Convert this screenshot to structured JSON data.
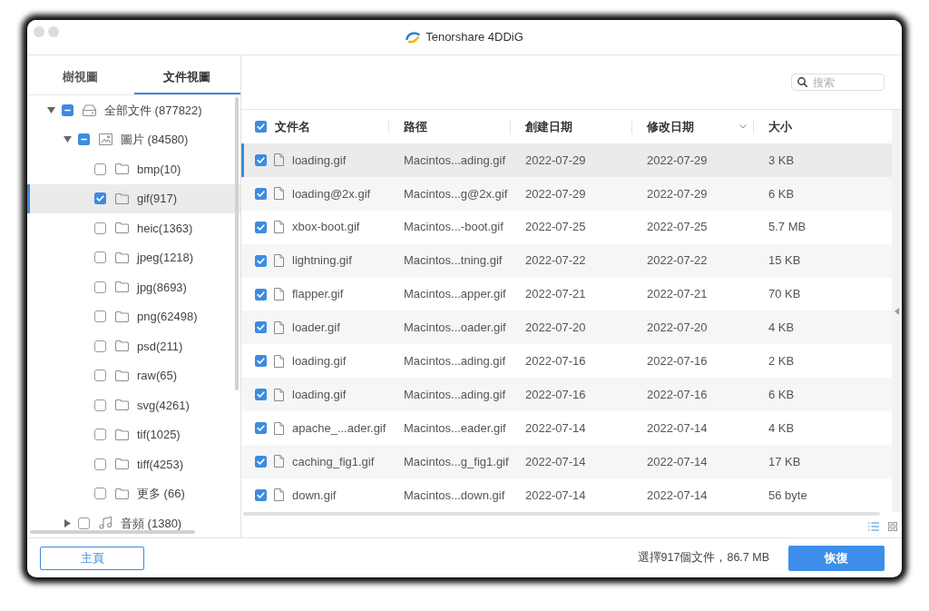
{
  "window": {
    "title": "Tenorshare 4DDiG"
  },
  "sidebar": {
    "tabs": [
      {
        "label": "樹視圖",
        "selected": false
      },
      {
        "label": "文件視圖",
        "selected": true
      }
    ],
    "tree": [
      {
        "kind": "drive",
        "label": "全部文件 (877822)",
        "checked": false,
        "indeterminate": true,
        "expanded": true,
        "selected": false,
        "children": [
          {
            "kind": "image",
            "label": "圖片 (84580)",
            "checked": false,
            "indeterminate": true,
            "expanded": true,
            "selected": false,
            "children": [
              {
                "kind": "folder",
                "label": "bmp(10)",
                "checked": false,
                "indeterminate": false,
                "selected": false
              },
              {
                "kind": "folder",
                "label": "gif(917)",
                "checked": true,
                "indeterminate": false,
                "selected": true
              },
              {
                "kind": "folder",
                "label": "heic(1363)",
                "checked": false,
                "indeterminate": false,
                "selected": false
              },
              {
                "kind": "folder",
                "label": "jpeg(1218)",
                "checked": false,
                "indeterminate": false,
                "selected": false
              },
              {
                "kind": "folder",
                "label": "jpg(8693)",
                "checked": false,
                "indeterminate": false,
                "selected": false
              },
              {
                "kind": "folder",
                "label": "png(62498)",
                "checked": false,
                "indeterminate": false,
                "selected": false
              },
              {
                "kind": "folder",
                "label": "psd(211)",
                "checked": false,
                "indeterminate": false,
                "selected": false
              },
              {
                "kind": "folder",
                "label": "raw(65)",
                "checked": false,
                "indeterminate": false,
                "selected": false
              },
              {
                "kind": "folder",
                "label": "svg(4261)",
                "checked": false,
                "indeterminate": false,
                "selected": false
              },
              {
                "kind": "folder",
                "label": "tif(1025)",
                "checked": false,
                "indeterminate": false,
                "selected": false
              },
              {
                "kind": "folder",
                "label": "tiff(4253)",
                "checked": false,
                "indeterminate": false,
                "selected": false
              },
              {
                "kind": "folder",
                "label": "更多 (66)",
                "checked": false,
                "indeterminate": false,
                "selected": false
              }
            ]
          },
          {
            "kind": "audio",
            "label": "音頻 (1380)",
            "checked": false,
            "indeterminate": false,
            "expanded": false,
            "selected": false
          }
        ]
      }
    ]
  },
  "search": {
    "placeholder": "搜索"
  },
  "table": {
    "all_checked": true,
    "columns": [
      {
        "label": "文件名",
        "sorted": false
      },
      {
        "label": "路徑",
        "sorted": false
      },
      {
        "label": "創建日期",
        "sorted": false
      },
      {
        "label": "修改日期",
        "sorted": true
      },
      {
        "label": "大小",
        "sorted": false
      }
    ],
    "rows": [
      {
        "name": "loading.gif",
        "path": "Macintos...ading.gif",
        "created": "2022-07-29",
        "modified": "2022-07-29",
        "size": "3 KB",
        "checked": true,
        "selected": true
      },
      {
        "name": "loading@2x.gif",
        "path": "Macintos...g@2x.gif",
        "created": "2022-07-29",
        "modified": "2022-07-29",
        "size": "6 KB",
        "checked": true,
        "selected": false
      },
      {
        "name": "xbox-boot.gif",
        "path": "Macintos...-boot.gif",
        "created": "2022-07-25",
        "modified": "2022-07-25",
        "size": "5.7 MB",
        "checked": true,
        "selected": false
      },
      {
        "name": "lightning.gif",
        "path": "Macintos...tning.gif",
        "created": "2022-07-22",
        "modified": "2022-07-22",
        "size": "15 KB",
        "checked": true,
        "selected": false
      },
      {
        "name": "flapper.gif",
        "path": "Macintos...apper.gif",
        "created": "2022-07-21",
        "modified": "2022-07-21",
        "size": "70 KB",
        "checked": true,
        "selected": false
      },
      {
        "name": "loader.gif",
        "path": "Macintos...oader.gif",
        "created": "2022-07-20",
        "modified": "2022-07-20",
        "size": "4 KB",
        "checked": true,
        "selected": false
      },
      {
        "name": "loading.gif",
        "path": "Macintos...ading.gif",
        "created": "2022-07-16",
        "modified": "2022-07-16",
        "size": "2 KB",
        "checked": true,
        "selected": false
      },
      {
        "name": "loading.gif",
        "path": "Macintos...ading.gif",
        "created": "2022-07-16",
        "modified": "2022-07-16",
        "size": "6 KB",
        "checked": true,
        "selected": false
      },
      {
        "name": "apache_...ader.gif",
        "path": "Macintos...eader.gif",
        "created": "2022-07-14",
        "modified": "2022-07-14",
        "size": "4 KB",
        "checked": true,
        "selected": false
      },
      {
        "name": "caching_fig1.gif",
        "path": "Macintos...g_fig1.gif",
        "created": "2022-07-14",
        "modified": "2022-07-14",
        "size": "17 KB",
        "checked": true,
        "selected": false
      },
      {
        "name": "down.gif",
        "path": "Macintos...down.gif",
        "created": "2022-07-14",
        "modified": "2022-07-14",
        "size": "56 byte",
        "checked": true,
        "selected": false
      }
    ]
  },
  "view_toggles": [
    {
      "kind": "list",
      "selected": true
    },
    {
      "kind": "grid",
      "selected": false
    }
  ],
  "footer": {
    "home_button": "主頁",
    "status": "選擇917個文件，86.7 MB",
    "recover_button": "恢復"
  }
}
